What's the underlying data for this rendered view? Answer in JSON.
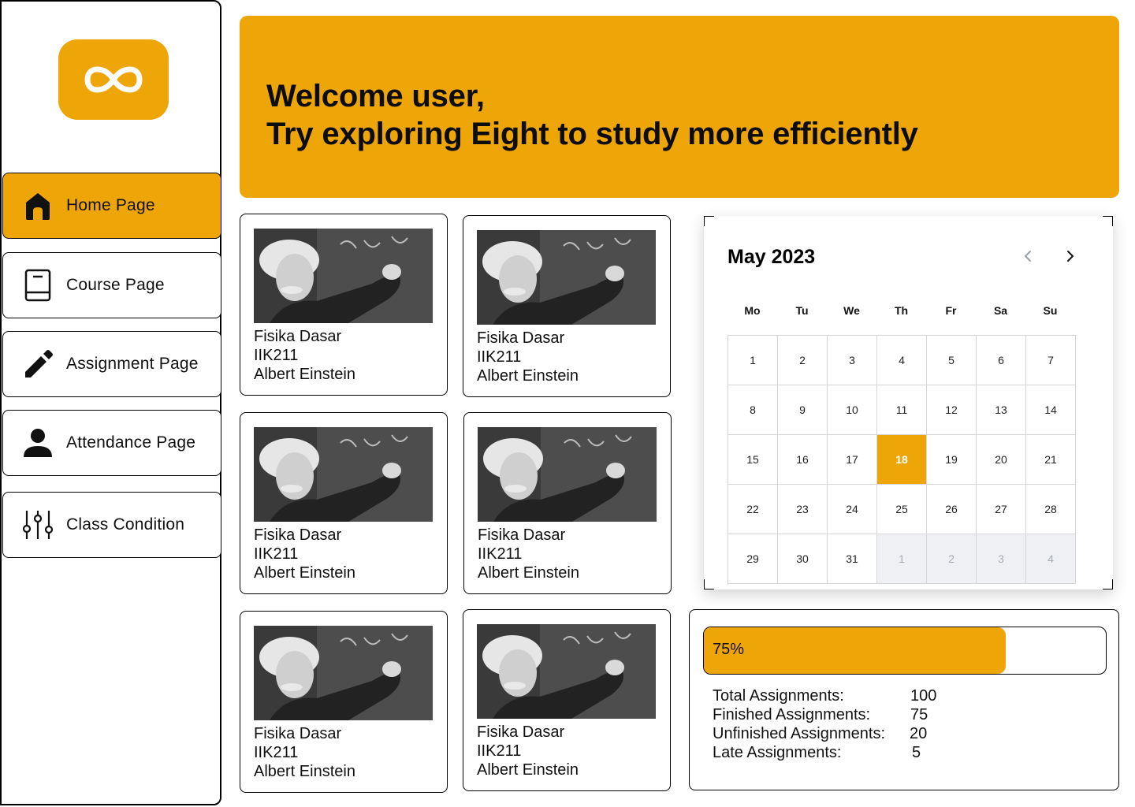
{
  "sidebar": {
    "logo_icon": "infinity-icon",
    "items": [
      {
        "label": "Home Page",
        "icon": "home-icon",
        "active": true
      },
      {
        "label": "Course Page",
        "icon": "book-icon",
        "active": false
      },
      {
        "label": "Assignment Page",
        "icon": "pencil-icon",
        "active": false
      },
      {
        "label": "Attendance Page",
        "icon": "person-icon",
        "active": false
      },
      {
        "label": "Class Condition",
        "icon": "sliders-icon",
        "active": false
      }
    ]
  },
  "banner": {
    "line1": "Welcome user,",
    "line2": "Try exploring Eight to study more efficiently"
  },
  "courses": [
    {
      "name": "Fisika Dasar",
      "code": "IIK211",
      "lecturer": "Albert Einstein"
    },
    {
      "name": "Fisika Dasar",
      "code": "IIK211",
      "lecturer": "Albert Einstein"
    },
    {
      "name": "Fisika Dasar",
      "code": "IIK211",
      "lecturer": "Albert Einstein"
    },
    {
      "name": "Fisika Dasar",
      "code": "IIK211",
      "lecturer": "Albert Einstein"
    },
    {
      "name": "Fisika Dasar",
      "code": "IIK211",
      "lecturer": "Albert Einstein"
    },
    {
      "name": "Fisika Dasar",
      "code": "IIK211",
      "lecturer": "Albert Einstein"
    }
  ],
  "calendar": {
    "title": "May 2023",
    "weekdays": [
      "Mo",
      "Tu",
      "We",
      "Th",
      "Fr",
      "Sa",
      "Su"
    ],
    "days": [
      "1",
      "2",
      "3",
      "4",
      "5",
      "6",
      "7",
      "8",
      "9",
      "10",
      "11",
      "12",
      "13",
      "14",
      "15",
      "16",
      "17",
      "18",
      "19",
      "20",
      "21",
      "22",
      "23",
      "24",
      "25",
      "26",
      "27",
      "28",
      "29",
      "30",
      "31",
      "1",
      "2",
      "3",
      "4"
    ],
    "selected_day": "18",
    "trailing_other_month_days": 4
  },
  "stats": {
    "progress_percent": 75,
    "progress_label": "75%",
    "rows": [
      {
        "label": "Total Assignments:",
        "value": "100"
      },
      {
        "label": "Finished Assignments:",
        "value": "75"
      },
      {
        "label": "Unfinished Assignments:",
        "value": "20"
      },
      {
        "label": "Late Assignments:",
        "value": "5"
      }
    ]
  },
  "colors": {
    "accent": "#EDA507"
  }
}
